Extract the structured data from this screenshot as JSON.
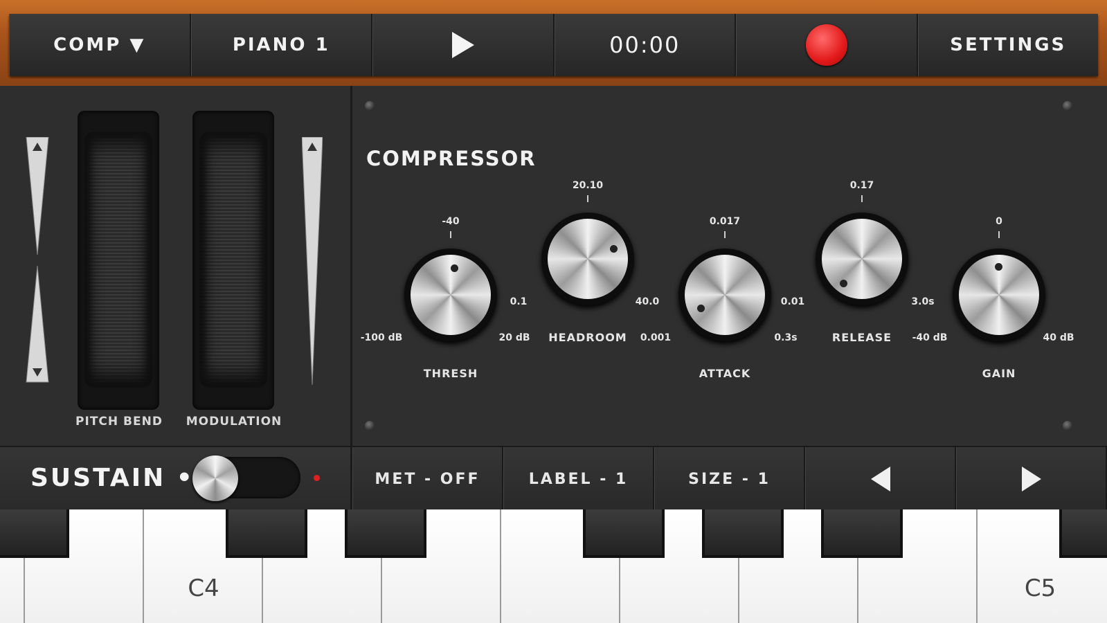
{
  "toolbar": {
    "comp_label": "COMP ▼",
    "preset_label": "PIANO 1",
    "play_icon": "play-icon",
    "time": "00:00",
    "record_icon": "record-icon",
    "record_color": "#e21919",
    "settings_label": "SETTINGS"
  },
  "left_panel": {
    "pitch_bend_label": "PITCH BEND",
    "modulation_label": "MODULATION"
  },
  "compressor": {
    "title": "COMPRESSOR",
    "knobs": [
      {
        "name": "THRESH",
        "value": "-40",
        "min": "-100 dB",
        "max": "20 dB"
      },
      {
        "name": "HEADROOM",
        "value": "20.10",
        "min": "0.1",
        "max": "40.0"
      },
      {
        "name": "ATTACK",
        "value": "0.017",
        "min": "0.001",
        "max": "0.3s"
      },
      {
        "name": "RELEASE",
        "value": "0.17",
        "min": "0.01",
        "max": "3.0s"
      },
      {
        "name": "GAIN",
        "value": "0",
        "min": "-40 dB",
        "max": "40 dB"
      }
    ]
  },
  "strip": {
    "sustain_label": "SUSTAIN •",
    "sustain_on": false,
    "met_label": "MET - OFF",
    "label_label": "LABEL - 1",
    "size_label": "SIZE - 1",
    "prev_icon": "triangle-left-icon",
    "next_icon": "triangle-right-icon"
  },
  "keyboard": {
    "labels": {
      "c4": "C4",
      "c5": "C5"
    }
  }
}
